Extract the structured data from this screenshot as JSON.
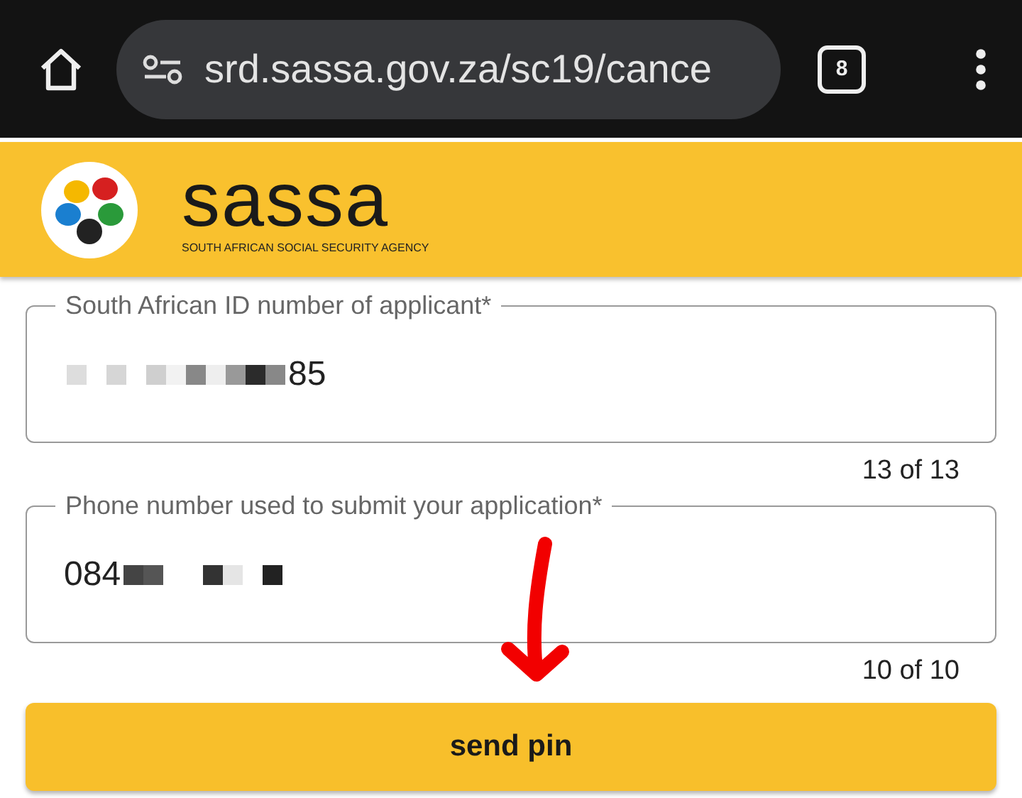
{
  "browser": {
    "url": "srd.sassa.gov.za/sc19/cance",
    "tab_count": "8"
  },
  "header": {
    "brand": "sassa",
    "tagline": "SOUTH AFRICAN SOCIAL SECURITY AGENCY"
  },
  "fields": [
    {
      "label": "South African ID number of applicant*",
      "value_parts": [
        {
          "kind": "redacted"
        },
        {
          "kind": "text",
          "text": "85"
        }
      ],
      "counter": "13 of 13"
    },
    {
      "label": "Phone number used to submit your application*",
      "value_parts": [
        {
          "kind": "text",
          "text": "084"
        },
        {
          "kind": "redacted"
        }
      ],
      "counter": "10 of 10"
    }
  ],
  "button": {
    "label": "send pin"
  }
}
